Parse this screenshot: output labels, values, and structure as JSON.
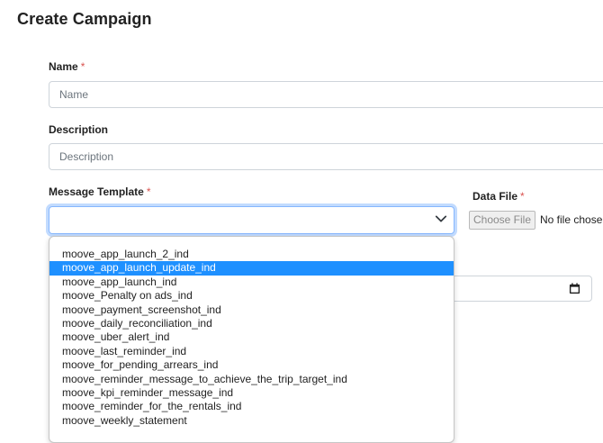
{
  "page": {
    "title": "Create Campaign"
  },
  "form": {
    "name": {
      "label": "Name",
      "required_mark": "*",
      "placeholder": "Name",
      "value": ""
    },
    "description": {
      "label": "Description",
      "placeholder": "Description",
      "value": ""
    },
    "message_template": {
      "label": "Message Template",
      "required_mark": "*",
      "selected_value": "",
      "highlighted": "moove_app_launch_update_ind",
      "options": [
        "moove_app_launch_2_ind",
        "moove_app_launch_update_ind",
        "moove_app_launch_ind",
        "moove_Penalty on ads_ind",
        "moove_payment_screenshot_ind",
        "moove_daily_reconciliation_ind",
        "moove_uber_alert_ind",
        "moove_last_reminder_ind",
        "moove_for_pending_arrears_ind",
        "moove_reminder_message_to_achieve_the_trip_target_ind",
        "moove_kpi_reminder_message_ind",
        "moove_reminder_for_the_rentals_ind",
        "moove_weekly_statement"
      ]
    },
    "data_file": {
      "label": "Data File",
      "required_mark": "*",
      "button_label": "Choose File",
      "status": "No file chosen"
    }
  },
  "colors": {
    "highlight": "#1e90ff",
    "required": "#d9534f",
    "focus_border": "#86b7fe"
  },
  "icons": {
    "select_chevron": "chevron-down-icon",
    "date_picker": "calendar-icon"
  }
}
